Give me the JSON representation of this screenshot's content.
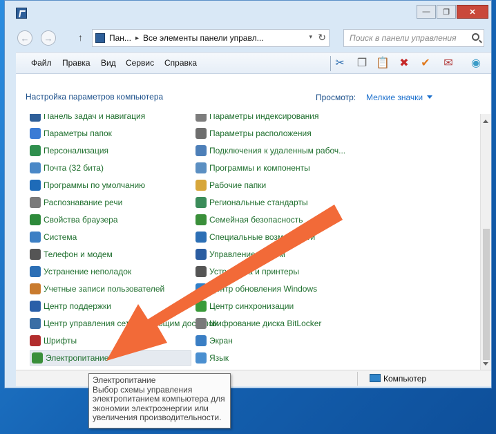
{
  "window": {
    "minimize_glyph": "—",
    "maximize_glyph": "❐",
    "close_glyph": "✕"
  },
  "address": {
    "back_glyph": "←",
    "forward_glyph": "→",
    "up_glyph": "↑",
    "segments": [
      "Пан...",
      "Все элементы панели управл..."
    ],
    "separator": "▸",
    "refresh_glyph": "↻",
    "dropdown_glyph": "▾",
    "search_placeholder": "Поиск в панели управления"
  },
  "menu": [
    "Файл",
    "Правка",
    "Вид",
    "Сервис",
    "Справка"
  ],
  "toolbar_icons": [
    {
      "name": "cut-icon",
      "glyph": "✂",
      "color": "#2b6cb0"
    },
    {
      "name": "copy-icon",
      "glyph": "❐",
      "color": "#666666"
    },
    {
      "name": "paste-icon",
      "glyph": "📋",
      "color": "#555555"
    },
    {
      "name": "delete-icon",
      "glyph": "✖",
      "color": "#c62828"
    },
    {
      "name": "checkmark-icon",
      "glyph": "✔",
      "color": "#e07a1f"
    },
    {
      "name": "properties-icon",
      "glyph": "✉",
      "color": "#b23a3a"
    },
    {
      "name": "shell-icon",
      "glyph": "◉",
      "color": "#3a9bc7"
    }
  ],
  "header": {
    "title": "Настройка параметров компьютера",
    "view_label": "Просмотр:",
    "view_value": "Мелкие значки"
  },
  "items_left": [
    {
      "label": "Панель задач и навигация",
      "icon": "taskbar-icon",
      "color": "#2e5f99"
    },
    {
      "label": "Параметры папок",
      "icon": "folder-options-icon",
      "color": "#3a7bd5"
    },
    {
      "label": "Персонализация",
      "icon": "personalization-icon",
      "color": "#2f8f4e"
    },
    {
      "label": "Почта (32 бита)",
      "icon": "mail-icon",
      "color": "#4a88c7"
    },
    {
      "label": "Программы по умолчанию",
      "icon": "default-programs-icon",
      "color": "#1e6bb8"
    },
    {
      "label": "Распознавание речи",
      "icon": "microphone-icon",
      "color": "#7a7a7a"
    },
    {
      "label": "Свойства браузера",
      "icon": "browser-icon",
      "color": "#2d8a3a"
    },
    {
      "label": "Система",
      "icon": "system-icon",
      "color": "#3c7fc4"
    },
    {
      "label": "Телефон и модем",
      "icon": "phone-icon",
      "color": "#555555"
    },
    {
      "label": "Устранение неполадок",
      "icon": "troubleshoot-icon",
      "color": "#2c6fb5"
    },
    {
      "label": "Учетные записи пользователей",
      "icon": "users-icon",
      "color": "#c97b2e"
    },
    {
      "label": "Центр поддержки",
      "icon": "flag-icon",
      "color": "#2a5fa8"
    },
    {
      "label": "Центр управления сетями и общим доступом",
      "icon": "network-icon",
      "color": "#3a6ea5"
    },
    {
      "label": "Шрифты",
      "icon": "fonts-icon",
      "color": "#b22d2d"
    },
    {
      "label": "Электропитание",
      "icon": "power-icon",
      "color": "#3a8f3a"
    }
  ],
  "items_right": [
    {
      "label": "Параметры индексирования",
      "icon": "indexing-icon",
      "color": "#7d7d7d"
    },
    {
      "label": "Параметры расположения",
      "icon": "location-icon",
      "color": "#6e6e6e"
    },
    {
      "label": "Подключения к удаленным рабоч...",
      "icon": "remote-desktop-icon",
      "color": "#4d7fb8"
    },
    {
      "label": "Программы и компоненты",
      "icon": "programs-icon",
      "color": "#5b8fc2"
    },
    {
      "label": "Рабочие папки",
      "icon": "work-folders-icon",
      "color": "#d7a63b"
    },
    {
      "label": "Региональные стандарты",
      "icon": "region-icon",
      "color": "#3b8c5a"
    },
    {
      "label": "Семейная безопасность",
      "icon": "family-safety-icon",
      "color": "#3a8f3a"
    },
    {
      "label": "Специальные возможности",
      "icon": "accessibility-icon",
      "color": "#2c6fb5"
    },
    {
      "label": "Управление цветом",
      "icon": "color-management-icon",
      "color": "#2b5da1"
    },
    {
      "label": "Устройства и принтеры",
      "icon": "printer-icon",
      "color": "#555555"
    },
    {
      "label": "Центр обновления Windows",
      "icon": "update-icon",
      "color": "#2f7fc8"
    },
    {
      "label": "Центр синхронизации",
      "icon": "sync-icon",
      "color": "#3a9a3a"
    },
    {
      "label": "Шифрование диска BitLocker",
      "icon": "bitlocker-icon",
      "color": "#7a7a7a"
    },
    {
      "label": "Экран",
      "icon": "display-icon",
      "color": "#3a7ec4"
    },
    {
      "label": "Язык",
      "icon": "language-icon",
      "color": "#4a8fd0"
    }
  ],
  "status": {
    "computer_label": "Компьютер"
  },
  "tooltip": {
    "title": "Электропитание",
    "lines": [
      "Выбор схемы управления",
      "электропитанием компьютера для",
      "экономии электроэнергии или",
      "увеличения производительности."
    ]
  },
  "colors": {
    "accent_arrow": "#f26a38",
    "link_green": "#1f6f2e",
    "heading_blue": "#1b4f8a"
  }
}
